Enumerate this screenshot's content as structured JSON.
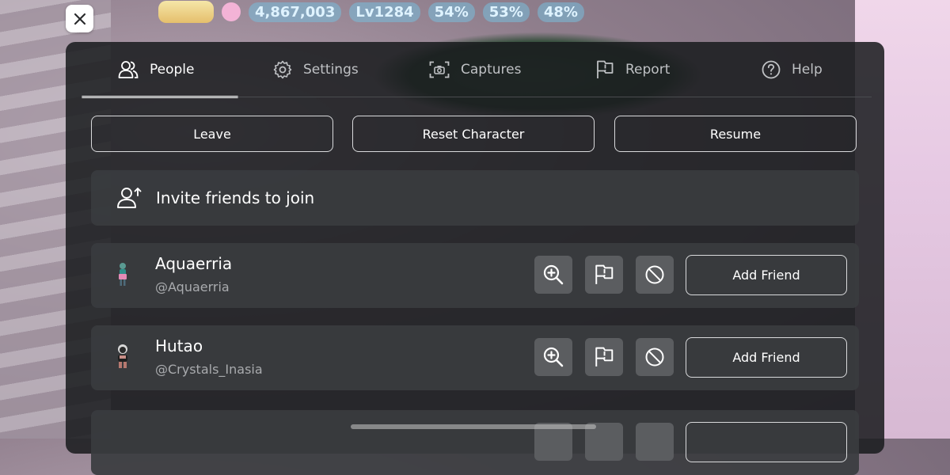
{
  "hud": {
    "gold": "4,867,003",
    "level": "Lv1284",
    "stat1": "54%",
    "stat2": "53%",
    "stat3": "48%"
  },
  "close_icon": "close-icon",
  "tabs": [
    {
      "label": "People",
      "icon": "people-icon",
      "active": true
    },
    {
      "label": "Settings",
      "icon": "gear-icon",
      "active": false
    },
    {
      "label": "Captures",
      "icon": "camera-icon",
      "active": false
    },
    {
      "label": "Report",
      "icon": "flag-icon",
      "active": false
    },
    {
      "label": "Help",
      "icon": "help-icon",
      "active": false
    }
  ],
  "actions": {
    "leave": "Leave",
    "reset": "Reset Character",
    "resume": "Resume"
  },
  "invite": {
    "label": "Invite friends to join",
    "icon": "add-person-icon"
  },
  "players": [
    {
      "name": "Aquaerria",
      "username": "@Aquaerria",
      "add_friend": "Add Friend"
    },
    {
      "name": "Hutao",
      "username": "@Crystals_Inasia",
      "add_friend": "Add Friend"
    }
  ],
  "colors": {
    "panel": "#191b1d",
    "row": "#3a3c3f",
    "icon_button": "#5b5d60",
    "text": "#ffffff",
    "subtext": "#a9abae"
  }
}
